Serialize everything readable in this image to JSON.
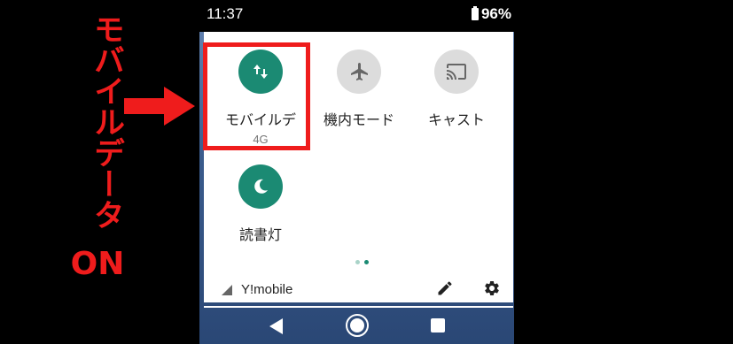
{
  "annotation": {
    "vertical_text": "モバイルデータ",
    "state_text": "ON",
    "color": "#ef1c1c"
  },
  "status_bar": {
    "time": "11:37",
    "battery": "96%"
  },
  "tiles": [
    {
      "label": "モバイルデ",
      "sub": "4G",
      "icon": "swap-vert-icon",
      "state": "on"
    },
    {
      "label": "機内モード",
      "icon": "airplane-icon",
      "state": "off"
    },
    {
      "label": "キャスト",
      "icon": "cast-icon",
      "state": "off"
    },
    {
      "label": "読書灯",
      "icon": "moon-icon",
      "state": "on"
    }
  ],
  "page_indicator": {
    "pages": 2,
    "current": 2
  },
  "footer": {
    "carrier": "Y!mobile",
    "edit_icon": "pencil-icon",
    "settings_icon": "gear-icon"
  },
  "nav": {
    "back_icon": "back-triangle-icon",
    "home_icon": "home-circle-icon",
    "recents_icon": "recents-square-icon"
  },
  "colors": {
    "accent": "#1b8a73",
    "inactive": "#dcdcdc",
    "highlight": "#ef1c1c"
  }
}
